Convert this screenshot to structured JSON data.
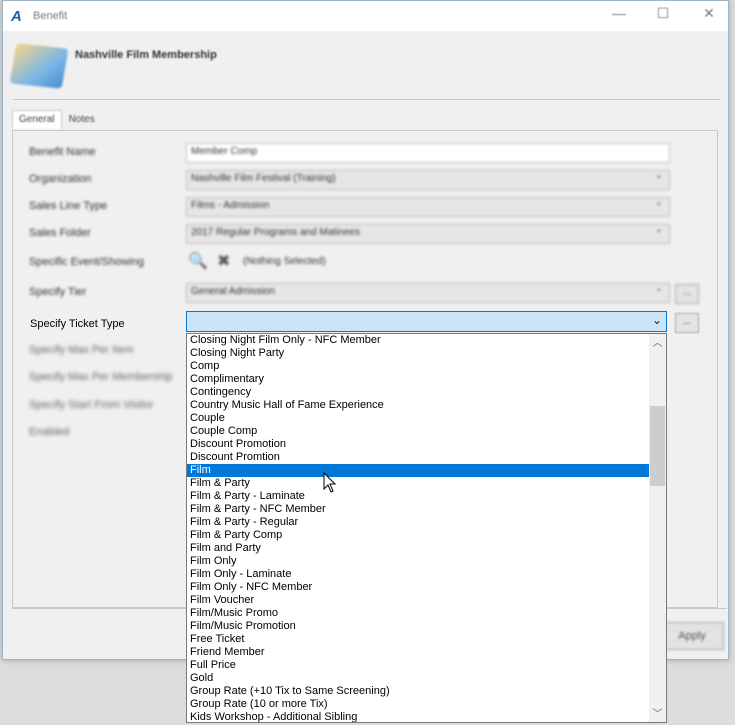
{
  "window": {
    "title": "Benefit",
    "minimize": "—",
    "maximize": "☐",
    "close": "✕"
  },
  "header": {
    "title": "Nashville Film Membership"
  },
  "tabs": [
    {
      "label": "General"
    },
    {
      "label": "Notes"
    }
  ],
  "form": {
    "benefit_name": {
      "label": "Benefit Name",
      "value": "Member Comp"
    },
    "organization": {
      "label": "Organization",
      "value": "Nashville Film Festival (Training)"
    },
    "sales_line_type": {
      "label": "Sales Line Type",
      "value": "Films - Admission"
    },
    "sales_folder": {
      "label": "Sales Folder",
      "value": "2017 Regular Programs and Matinees"
    },
    "specific_event": {
      "label": "Specific Event/Showing",
      "value": "(Nothing Selected)"
    },
    "specify_tier": {
      "label": "Specify Tier",
      "value": "General Admission",
      "button": "..."
    },
    "ticket_type": {
      "label": "Specify Ticket Type",
      "value": "",
      "button": "..."
    },
    "hidden_labels": [
      "Specify Max Per Item",
      "Specify Max Per Membership",
      "Specify Start From Visitor",
      "Enabled"
    ]
  },
  "footer": {
    "apply_label": "Apply"
  },
  "dropdown": {
    "options": [
      "Closing Night Film Only - NFC Member",
      "Closing Night Party",
      "Comp",
      "Complimentary",
      "Contingency",
      "Country Music Hall of Fame Experience",
      "Couple",
      "Couple Comp",
      "Discount Promotion",
      "Discount Promtion",
      "Film",
      "Film & Party",
      "Film & Party - Laminate",
      "Film & Party - NFC Member",
      "Film & Party - Regular",
      "Film & Party Comp",
      "Film and Party",
      "Film Only",
      "Film Only - Laminate",
      "Film Only - NFC Member",
      "Film Voucher",
      "Film/Music Promo",
      "Film/Music Promotion",
      "Free Ticket",
      "Friend Member",
      "Full Price",
      "Gold",
      "Group Rate (+10 Tix to Same Screening)",
      "Group Rate (10 or more Tix)",
      "Kids Workshop - Additional Sibling"
    ],
    "selected": "Film"
  }
}
